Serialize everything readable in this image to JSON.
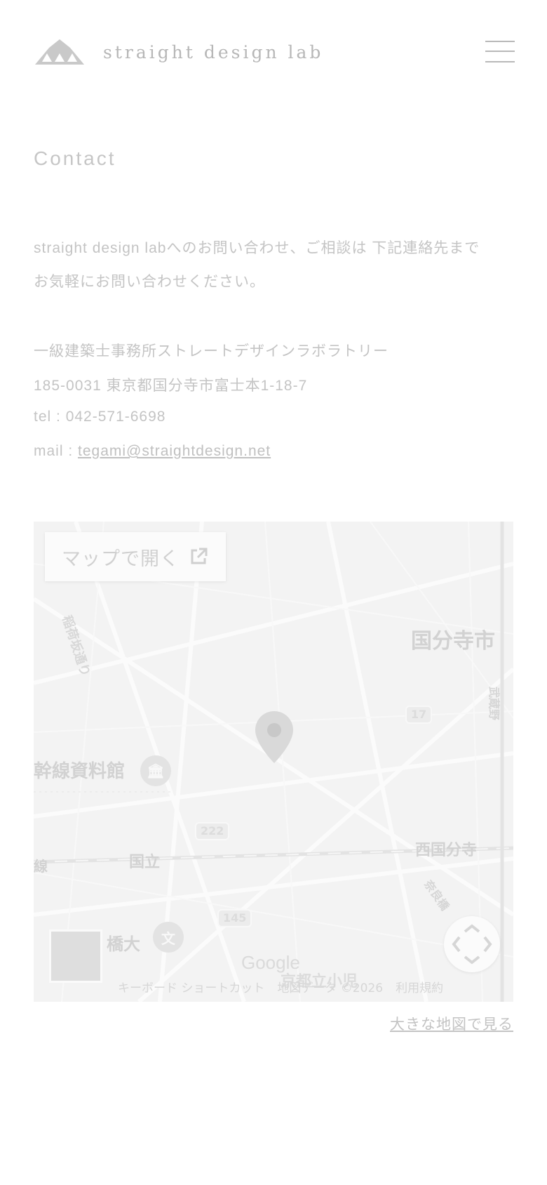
{
  "header": {
    "brand": "straight design lab",
    "logo_icon": "mountain-logo-icon",
    "menu_icon": "hamburger-menu-icon"
  },
  "page_title": "Contact",
  "intro": {
    "line1": "straight design labへのお問い合わせ、ご相談は 下記連絡先まで",
    "line2": "お気軽にお問い合わせください。"
  },
  "office": {
    "name": "一級建築士事務所ストレートデザインラボラトリー",
    "address": "185-0031 東京都国分寺市富士本1-18-7",
    "tel_label": "tel : ",
    "tel": "042-571-6698",
    "mail_label": "mail : ",
    "mail": "tegami@straightdesign.net"
  },
  "map": {
    "open_in_maps": "マップで開く",
    "labels": {
      "kokubunji_city": "国分寺市",
      "inari_street": "稲荷坂通り",
      "shinkansen_museum": "幹線資料館",
      "line_fragment": "線",
      "kunitachi": "国立",
      "nishi_kokubunji": "西国分寺",
      "nara_bypass": "奈良橋",
      "musashi": "武蔵野",
      "university": "橋大",
      "school": "京都立小児"
    },
    "routes": [
      "17",
      "222",
      "145"
    ],
    "attribution": "Google",
    "footer": {
      "shortcuts": "キーボード ショートカット",
      "map_data": "地図データ ©2026",
      "terms": "利用規約"
    }
  },
  "larger_map_link": "大きな地図で見る",
  "colors": {
    "text": "#c4c4c4",
    "map_bg": "#f4f4f4",
    "road": "#fbfbfb"
  }
}
